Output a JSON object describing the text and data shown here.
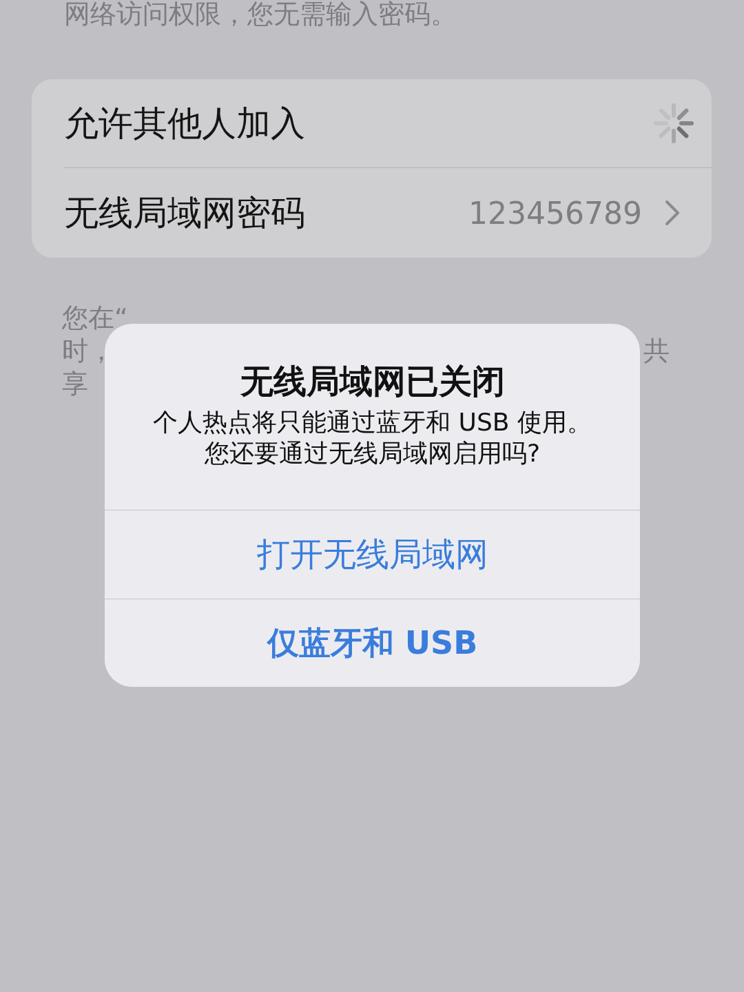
{
  "description": "网络访问权限，您无需输入密码。",
  "settings": [
    {
      "kind": "spinner",
      "label": "允许其他人加入"
    },
    {
      "kind": "disclosure",
      "label": "无线局域网密码",
      "value": "123456789"
    }
  ],
  "footnote_lines": [
    [
      "您在“"
    ],
    [
      "时，",
      "共"
    ],
    [
      "享"
    ]
  ],
  "alert": {
    "title": "无线局域网已关闭",
    "message": [
      "个人热点将只能通过蓝牙和 USB 使用。",
      "您还要通过无线局域网启用吗?"
    ],
    "buttons": [
      {
        "label": "打开无线局域网",
        "preferred": false
      },
      {
        "label": "仅蓝牙和 USB",
        "preferred": true
      }
    ]
  }
}
